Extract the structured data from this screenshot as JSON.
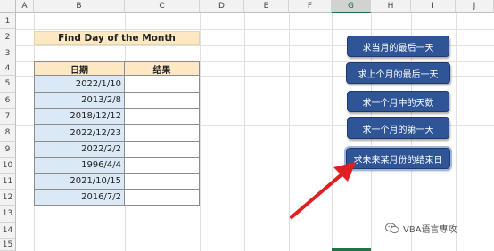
{
  "columns": [
    "A",
    "B",
    "C",
    "D",
    "E",
    "F",
    "G",
    "H",
    "I",
    "J"
  ],
  "selected_column": "G",
  "rows": [
    "1",
    "2",
    "3",
    "4",
    "5",
    "6",
    "7",
    "8",
    "9",
    "10",
    "11",
    "12",
    "13",
    "14",
    "15"
  ],
  "title": "Find Day of the Month",
  "table": {
    "headers": [
      "日期",
      "结果"
    ],
    "dates": [
      "2022/1/10",
      "2013/2/8",
      "2018/12/12",
      "2022/12/23",
      "2022/2/2",
      "1996/4/4",
      "2021/10/15",
      "2016/7/2"
    ]
  },
  "buttons": [
    "求当月的最后一天",
    "求上个月的最后一天",
    "求一个月中的天数",
    "求一个月的第一天",
    "求未来某月份的结束日"
  ],
  "annotation": {
    "arrow_color": "#e02020",
    "points_to": "求未来某月份的结束日"
  },
  "watermark": {
    "text": "VBA语言專攻",
    "icon": "wechat-icon"
  },
  "colors": {
    "title_bg": "#fce9c4",
    "date_bg": "#dbe8f5",
    "button_bg": "#2f5597",
    "accent": "#217346"
  }
}
